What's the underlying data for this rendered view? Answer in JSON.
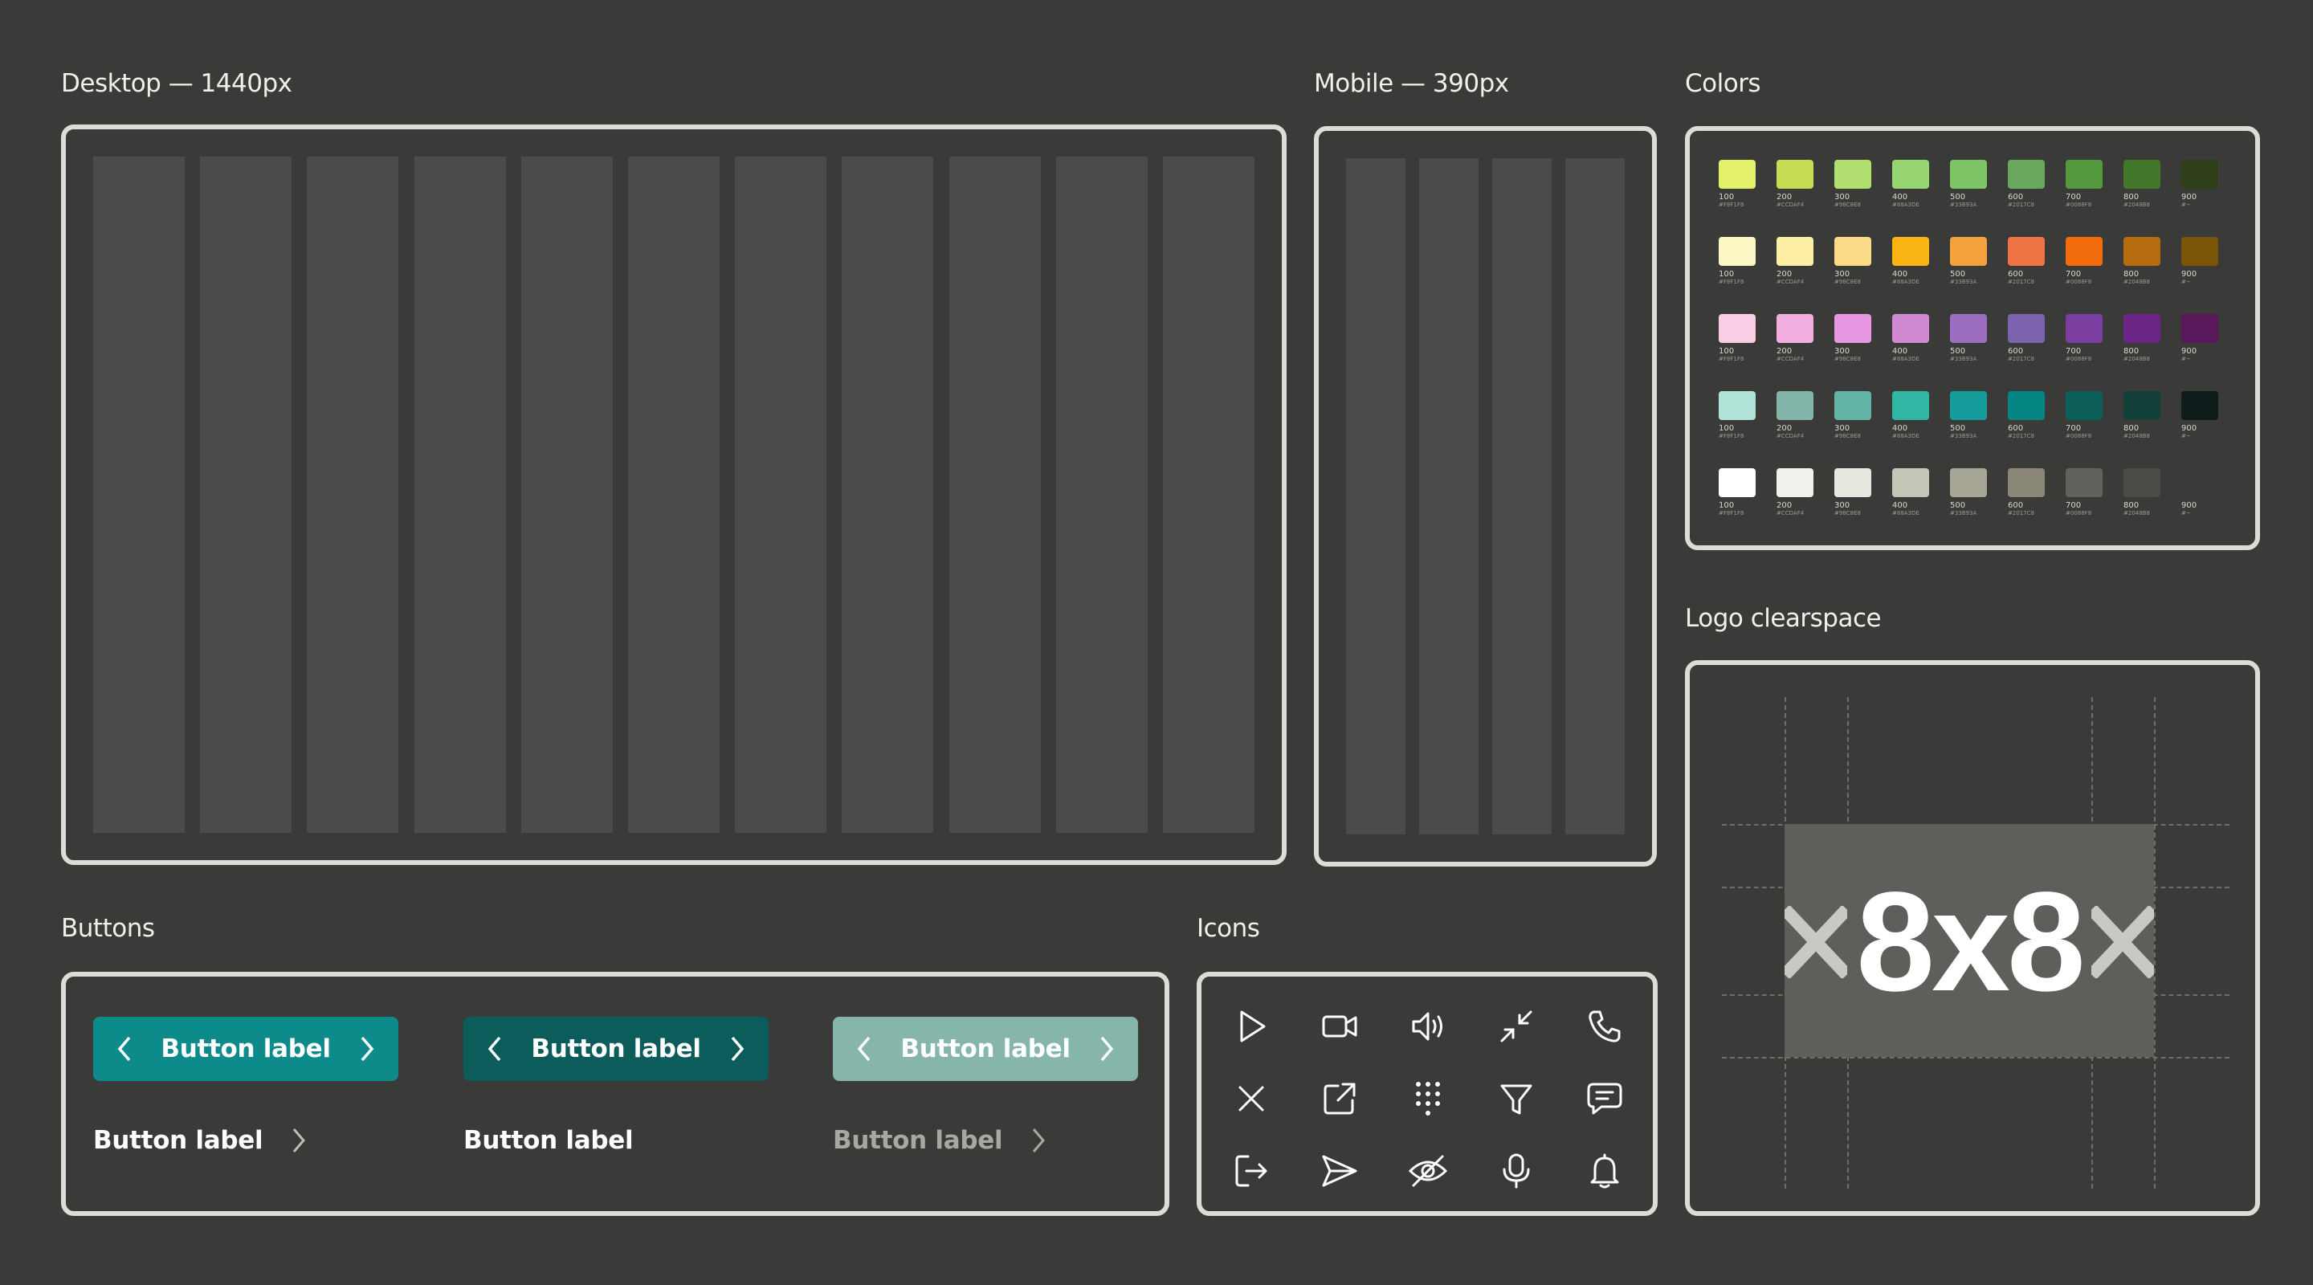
{
  "sections": {
    "desktop": "Desktop — 1440px",
    "mobile": "Mobile — 390px",
    "colors": "Colors",
    "logo": "Logo clearspace",
    "buttons": "Buttons",
    "icons": "Icons"
  },
  "desktop_grid": {
    "columns": 11
  },
  "mobile_grid": {
    "columns": 4
  },
  "color_palette": {
    "shades": [
      "100",
      "200",
      "300",
      "400",
      "500",
      "600",
      "700",
      "800",
      "900"
    ],
    "hex_codes": [
      "#F8F1F8",
      "#CCDAF4",
      "#98C8E8",
      "#88A3DE",
      "#33B93A",
      "#2017C8",
      "#0088F8",
      "#2048B8",
      "#~"
    ],
    "rows": [
      {
        "name": "green",
        "colors": [
          "#e2f06a",
          "#c8dc55",
          "#b1e070",
          "#98d672",
          "#7ec568",
          "#6aa85e",
          "#55993e",
          "#43772a",
          "#2f3f1a"
        ]
      },
      {
        "name": "orange",
        "colors": [
          "#fdf7c6",
          "#fdf0a5",
          "#fcdb88",
          "#fab514",
          "#f4a23e",
          "#ef7443",
          "#f26b0c",
          "#b76b11",
          "#7a5508"
        ]
      },
      {
        "name": "purple",
        "colors": [
          "#f9cde4",
          "#f3aee0",
          "#e897e3",
          "#d189d1",
          "#9c6ec1",
          "#7b64ad",
          "#7a3ea0",
          "#6a2587",
          "#591859"
        ]
      },
      {
        "name": "teal",
        "colors": [
          "#b0e2d8",
          "#84b5ab",
          "#62b4a6",
          "#30b6a4",
          "#169d9b",
          "#068585",
          "#0b5e5a",
          "#14403a",
          "#0d1c1a"
        ]
      },
      {
        "name": "neutral",
        "colors": [
          "#ffffff",
          "#f1f1ec",
          "#e8e8e0",
          "#c5c5b8",
          "#a6a596",
          "#8a8678",
          "#62625c",
          "#4a4a46",
          "#3a3a38"
        ]
      }
    ]
  },
  "buttons": {
    "primary": "Button label",
    "dark": "Button label",
    "disabled": "Button label",
    "text_primary": "Button label",
    "text_dark": "Button label",
    "text_disabled": "Button label",
    "colors": {
      "primary": "#0c8b8a",
      "dark": "#0b5c5a",
      "disabled": "#86b6ab"
    }
  },
  "icons": [
    "play-icon",
    "video-camera-icon",
    "volume-icon",
    "minimize-icon",
    "phone-icon",
    "close-icon",
    "external-link-icon",
    "dial-pad-icon",
    "filter-icon",
    "chat-icon",
    "logout-icon",
    "send-icon",
    "eye-off-icon",
    "microphone-icon",
    "bell-icon"
  ],
  "logo": {
    "text": "8x8"
  }
}
